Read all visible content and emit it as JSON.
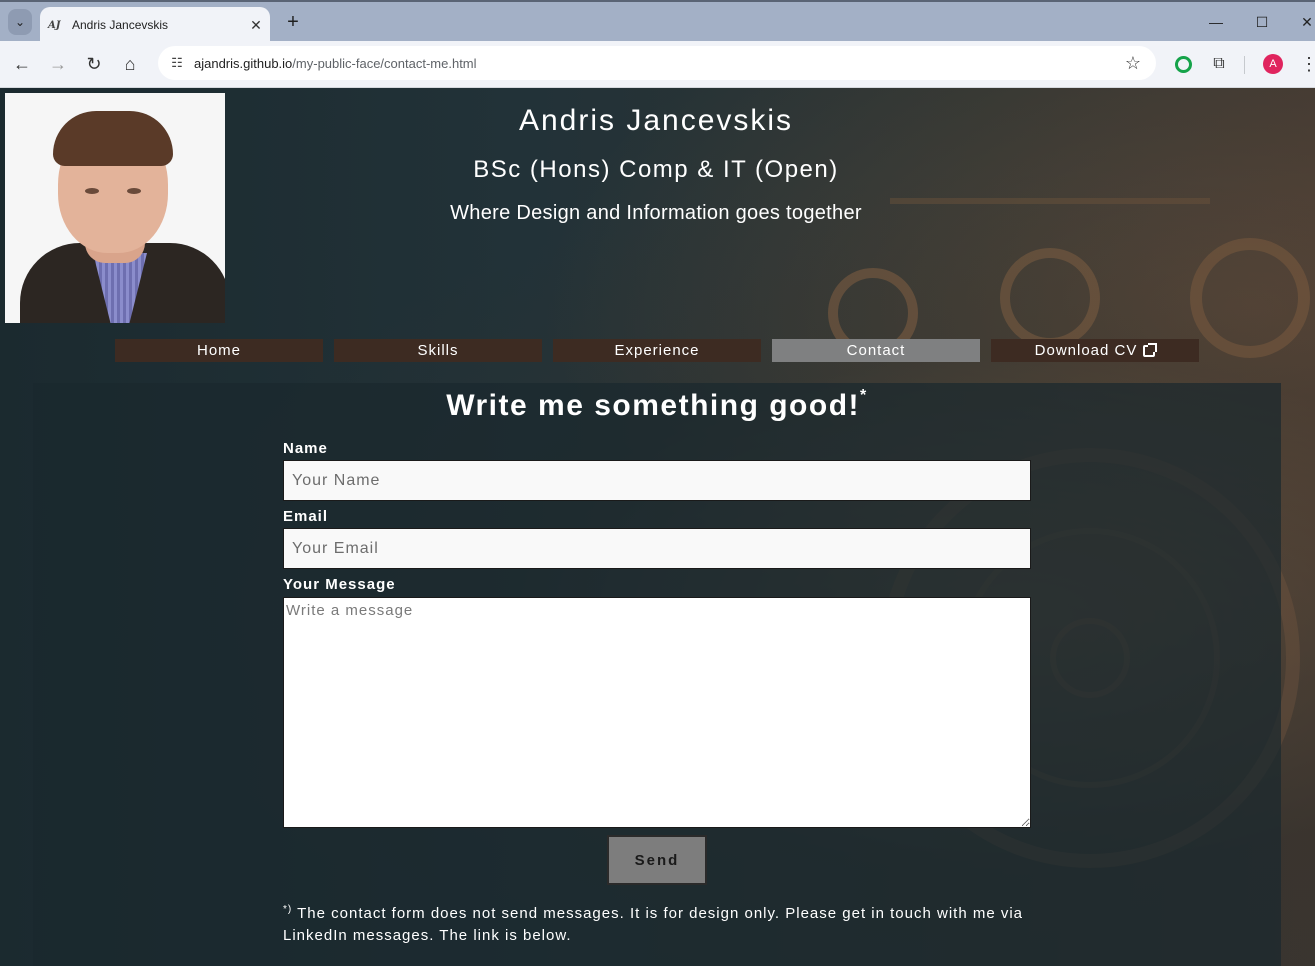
{
  "browser": {
    "tab_title": "Andris Jancevskis",
    "favicon_text": "AJ",
    "url_host": "ajandris.github.io",
    "url_path": "/my-public-face/contact-me.html",
    "profile_initial": "A"
  },
  "header": {
    "name": "Andris Jancevskis",
    "degree": "BSc (Hons) Comp & IT (Open)",
    "tagline": "Where Design and Information goes together"
  },
  "nav": {
    "items": [
      {
        "label": "Home",
        "active": false
      },
      {
        "label": "Skills",
        "active": false
      },
      {
        "label": "Experience",
        "active": false
      },
      {
        "label": "Contact",
        "active": true
      },
      {
        "label": "Download CV",
        "active": false
      }
    ]
  },
  "form": {
    "title": "Write me something good!",
    "title_mark": "*",
    "name_label": "Name",
    "name_placeholder": "Your Name",
    "email_label": "Email",
    "email_placeholder": "Your Email",
    "message_label": "Your Message",
    "message_placeholder": "Write a message",
    "send_label": "Send",
    "note_mark": "*)",
    "note_text": " The contact form does not send messages. It is for design only. Please get in touch with me via LinkedIn messages. The link is below."
  },
  "colors": {
    "nav_bg": "#3d2b22",
    "nav_active_bg": "#7f8081",
    "panel_bg": "#1b282e",
    "send_bg": "#7d7d7d"
  }
}
